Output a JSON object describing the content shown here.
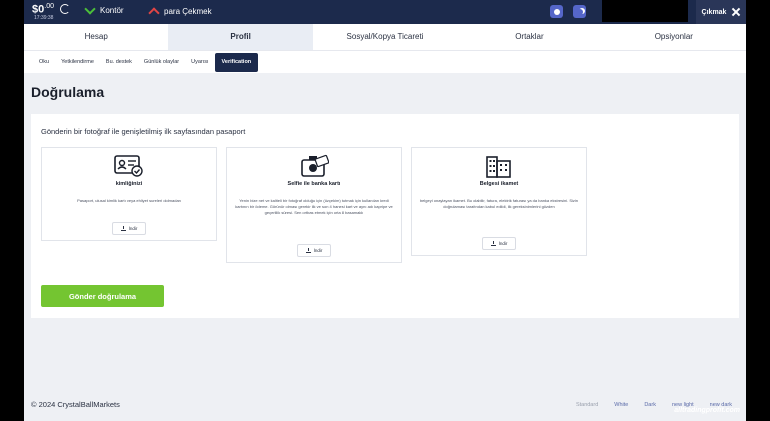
{
  "topbar": {
    "balance_main": "$0",
    "balance_cents": ".00",
    "time": "17:39:38",
    "deposit_label": "Kontör",
    "withdraw_label": "para Çekmek",
    "logout_label": "Çıkmak"
  },
  "main_tabs": [
    "Hesap",
    "Profil",
    "Sosyal/Kopya Ticareti",
    "Ortaklar",
    "Opsiyonlar"
  ],
  "sub_tabs": [
    "Oku",
    "Yetkilendirme",
    "Bu. destek",
    "Günlük olaylar",
    "Uyarısı",
    "Verification"
  ],
  "page": {
    "title": "Doğrulama",
    "subtitle": "Gönderin bir fotoğraf ile genişletilmiş ilk sayfasından pasaport",
    "submit_label": "Gönder doğrulama"
  },
  "documents": [
    {
      "title": "kimliğinizi",
      "icon": "id-card-icon",
      "description": "Pasaport, ulusal kimlik kartı veya ehliyet sureleri dolmadan",
      "button": "İndir"
    },
    {
      "title": "Selfie ile banka kartı",
      "icon": "selfie-card-icon",
      "description": "Yenin bize net ve kaliteli bir fotoğraf olduğu için (üzçekim) tutmak için kullanılan kredi kartının bir ödeme. Görünür olması gerekir ilk ve son 4 hanesi kart ve aynı adı kapripe ve geçerlilik süresi. Sen ortbas etmek için orta 8 basamaklı",
      "button": "İndir"
    },
    {
      "title": "Belgesi ikamet",
      "icon": "building-icon",
      "description": "belgeyi onaylayan ikamet. Bu olabilir, fatura, elektrik faturası ya da banka ekstresini. Sizin doğrulaması tarafından kabul edildi, ilk gereksinimlerini gözden",
      "button": "İndir"
    }
  ],
  "footer": {
    "copyright": "© 2024 CrystalBallMarkets",
    "themes": [
      "Standard",
      "White",
      "Dark",
      "new light",
      "new dark"
    ]
  },
  "watermark": "alltradingprofit.com",
  "colors": {
    "topbar": "#1c2a4c",
    "accent_green": "#74c531",
    "active_subtab": "#1c2a4c"
  }
}
